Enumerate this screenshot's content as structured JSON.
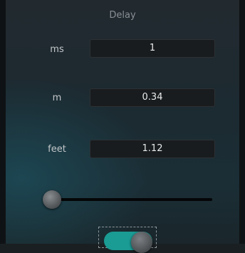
{
  "panel": {
    "title": "Delay"
  },
  "rows": [
    {
      "label": "ms",
      "value": "1"
    },
    {
      "label": "m",
      "value": "0.34"
    },
    {
      "label": "feet",
      "value": "1.12"
    }
  ],
  "slider": {
    "level": 0
  },
  "toggle": {
    "state": "on",
    "accent_color": "#1a9b94"
  },
  "colors": {
    "background": "#1c2a31",
    "field_background": "#191c1e",
    "text": "#e8eaeb",
    "label": "#c3c7ca"
  }
}
